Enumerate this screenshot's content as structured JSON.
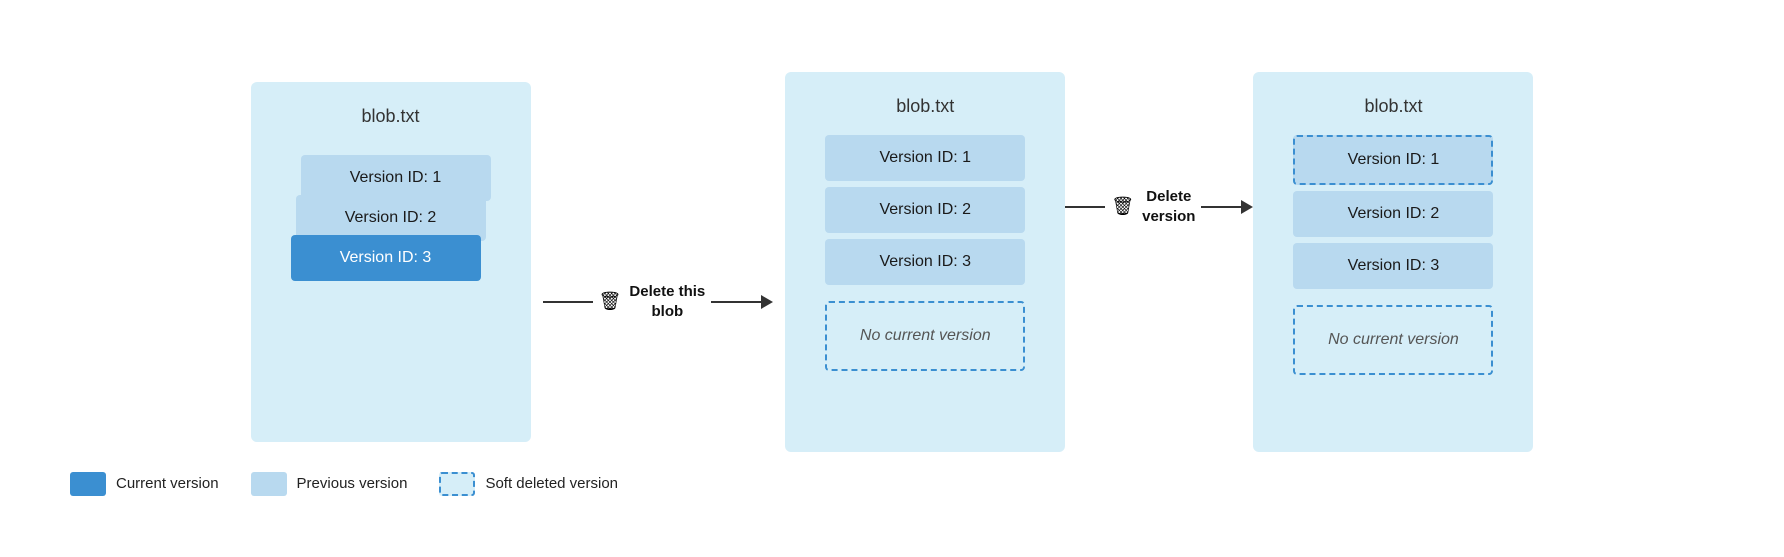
{
  "diagram": {
    "blob1": {
      "title": "blob.txt",
      "versions": [
        {
          "label": "Version ID: 1",
          "type": "light"
        },
        {
          "label": "Version ID: 2",
          "type": "light"
        },
        {
          "label": "Version ID: 3",
          "type": "current"
        }
      ],
      "action": {
        "icon": "🗑",
        "line1": "Delete this",
        "line2": "blob"
      }
    },
    "blob2": {
      "title": "blob.txt",
      "versions": [
        {
          "label": "Version ID: 1",
          "type": "light"
        },
        {
          "label": "Version ID: 2",
          "type": "light"
        },
        {
          "label": "Version ID: 3",
          "type": "light"
        }
      ],
      "no_current": "No current version",
      "action": {
        "icon": "🗑",
        "line1": "Delete",
        "line2": "version"
      }
    },
    "blob3": {
      "title": "blob.txt",
      "versions": [
        {
          "label": "Version ID: 1",
          "type": "soft-deleted"
        },
        {
          "label": "Version ID: 2",
          "type": "light"
        },
        {
          "label": "Version ID: 3",
          "type": "light"
        }
      ],
      "no_current": "No current version"
    }
  },
  "legend": {
    "items": [
      {
        "label": "Current version",
        "type": "current"
      },
      {
        "label": "Previous version",
        "type": "previous"
      },
      {
        "label": "Soft deleted version",
        "type": "soft-deleted"
      }
    ]
  }
}
